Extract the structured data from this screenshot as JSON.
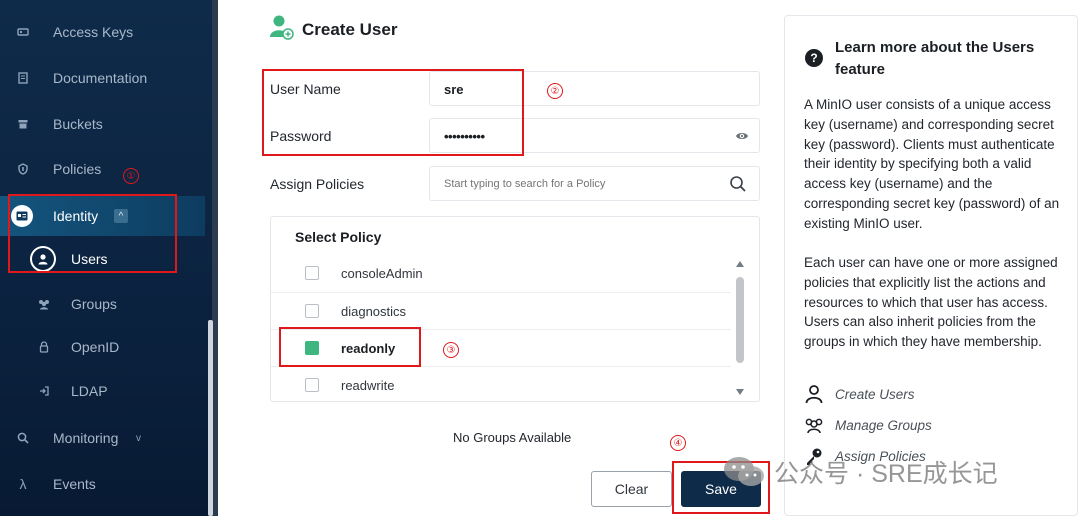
{
  "sidebar": {
    "items": [
      {
        "label": "Access Keys",
        "icon": "key-icon"
      },
      {
        "label": "Documentation",
        "icon": "document-icon"
      },
      {
        "label": "Buckets",
        "icon": "bucket-icon"
      },
      {
        "label": "Policies",
        "icon": "shield-icon"
      },
      {
        "label": "Identity",
        "icon": "id-card-icon"
      },
      {
        "label": "Users",
        "icon": "user-icon"
      },
      {
        "label": "Groups",
        "icon": "groups-icon"
      },
      {
        "label": "OpenID",
        "icon": "lock-icon"
      },
      {
        "label": "LDAP",
        "icon": "login-icon"
      },
      {
        "label": "Monitoring",
        "icon": "monitoring-icon"
      },
      {
        "label": "Events",
        "icon": "lambda-icon"
      }
    ],
    "identity_chevron": "^",
    "monitoring_chevron": "v"
  },
  "form": {
    "title": "Create User",
    "username_label": "User Name",
    "username_value": "sre",
    "password_label": "Password",
    "password_value": "••••••••••",
    "assign_label": "Assign Policies",
    "policy_search_placeholder": "Start typing to search for a Policy",
    "policy_header": "Select  Policy",
    "policies": [
      {
        "name": "consoleAdmin",
        "checked": false
      },
      {
        "name": "diagnostics",
        "checked": false
      },
      {
        "name": "readonly",
        "checked": true
      },
      {
        "name": "readwrite",
        "checked": false
      }
    ],
    "no_groups": "No Groups Available",
    "clear_label": "Clear",
    "save_label": "Save"
  },
  "help": {
    "title": "Learn more about the Users feature",
    "para1": "A MinIO user consists of a unique access key (username) and corresponding secret key (password). Clients must authenticate their identity by specifying both a valid access key (username) and the corresponding secret key (password) of an existing MinIO user.",
    "para2": "Each user can have one or more assigned policies that explicitly list the actions and resources to which that user has access. Users can also inherit policies from the groups in which they have membership.",
    "links": [
      "Create Users",
      "Manage Groups",
      "Assign Policies"
    ]
  },
  "annotations": [
    "①",
    "②",
    "③",
    "④"
  ],
  "watermark": "公众号 · SRE成长记",
  "colors": {
    "accent": "#3fb57f",
    "brand": "#0f2b4a",
    "annotation": "#e0181b"
  }
}
